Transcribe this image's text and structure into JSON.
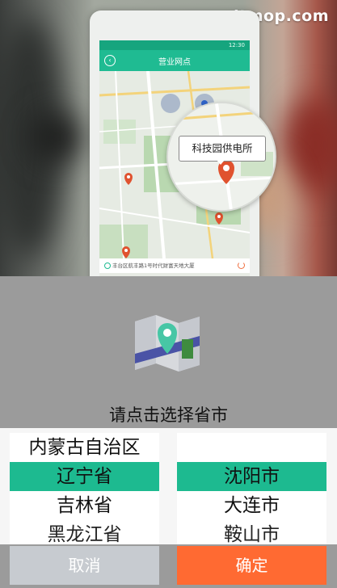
{
  "watermark": "www.itmop.com",
  "phone": {
    "status_time": "12:30",
    "title": "营业网点",
    "address": "丰台区航丰路1号时代财富天地大厦",
    "callout": "科技园供电所"
  },
  "dialog": {
    "title": "请点击选择省市",
    "provinces": [
      "内蒙古自治区",
      "辽宁省",
      "吉林省",
      "黑龙江省"
    ],
    "selected_province": "辽宁省",
    "cities": [
      "",
      "沈阳市",
      "大连市",
      "鞍山市"
    ],
    "selected_city": "沈阳市",
    "cancel_label": "取消",
    "confirm_label": "确定"
  },
  "colors": {
    "accent_green": "#1dba90",
    "confirm_orange": "#ff6a32",
    "cancel_gray": "#c7cbd0"
  }
}
